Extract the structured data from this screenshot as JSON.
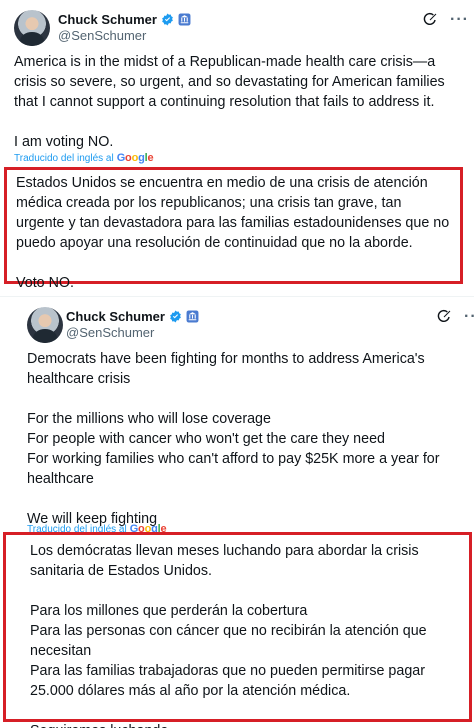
{
  "tweet1": {
    "author_name": "Chuck Schumer",
    "handle": "@SenSchumer",
    "body": "America is in the midst of a Republican-made health care crisis—a crisis so severe, so urgent, and so devastating for American families that I cannot support a continuing resolution that fails to address it.\n\nI am voting NO.",
    "translated_label": "Traducido del inglés al",
    "translated_brand": "Google",
    "translation": "Estados Unidos se encuentra en medio de una crisis de atención médica creada por los republicanos; una crisis tan grave, tan urgente y tan devastadora para las familias estadounidenses que no puedo apoyar una resolución de continuidad que no la aborde.\n\nVoto NO."
  },
  "tweet2": {
    "author_name": "Chuck Schumer",
    "handle": "@SenSchumer",
    "body": "Democrats have been fighting for months to address America's healthcare crisis\n\nFor the millions who will lose coverage\nFor people with cancer who won't get the care they need\nFor working families who can't afford to pay $25K more a year for healthcare\n\nWe will keep fighting",
    "translated_label": "Traducido del inglés al",
    "translated_brand": "Google",
    "translation": "Los demócratas llevan meses luchando para abordar la crisis sanitaria de Estados Unidos.\n\nPara los millones que perderán la cobertura\nPara las personas con cáncer que no recibirán la atención que necesitan\nPara las familias trabajadoras que no pueden permitirse pagar 25.000 dólares más al año por la atención médica.\n\nSeguiremos luchando"
  },
  "icons": {
    "verified": "verified-badge-icon",
    "government": "government-badge-icon",
    "grok": "grok-icon",
    "more": "more-options-icon"
  },
  "colors": {
    "highlight_border": "#d61f26",
    "verified_blue": "#1d9bf0",
    "link_blue": "#1d9bf0"
  }
}
